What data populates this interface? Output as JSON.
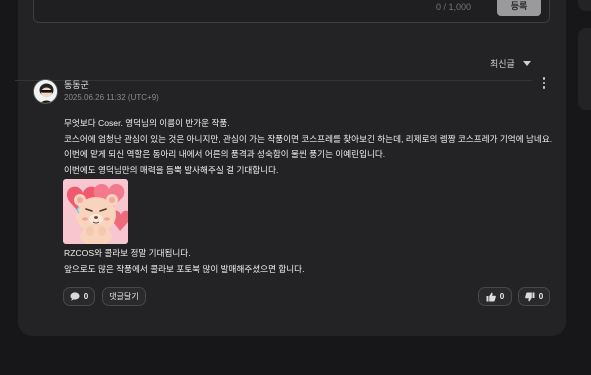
{
  "editor": {
    "char_count": "0 / 1,000",
    "submit_label": "등록"
  },
  "sort": {
    "selected": "최신글"
  },
  "comment": {
    "author": "동동군",
    "date": "2025.06.26 11:32 (UTC+9)",
    "lines": [
      "무엇보다 Coser. 영덕님의 이름이 반가운 작품.",
      "코스어에 엄청난 관심이 있는 것은 아니지만, 관심이 가는 작품이면 코스프레를 찾아보긴 하는데, 리제로의 렘짱 코스프레가 기억에 남네요.",
      "이번에 맡게 되신 역할은 동아리 내에서 어른의 품격과 성숙함이 물씬 풍기는 이예린입니다.",
      "이번에도 영덕님만의 매력을 듬뿍 발사해주실 걸 기대합니다."
    ],
    "lines_after_sticker": [
      "RZCOS와  콜라보 정말 기대됩니다.",
      "앞으로도 많은 작품에서 콜라보 포토북 많이 발매해주셨으면 합니다."
    ],
    "reply_count": "0",
    "reply_button_label": "댓글달기",
    "like_count": "0",
    "dislike_count": "0"
  },
  "icons": {
    "reply": "speech-bubble-icon",
    "like": "thumbs-up-icon",
    "dislike": "thumbs-down-icon",
    "more": "more-vertical-icon",
    "sort": "chevron-down-icon"
  }
}
